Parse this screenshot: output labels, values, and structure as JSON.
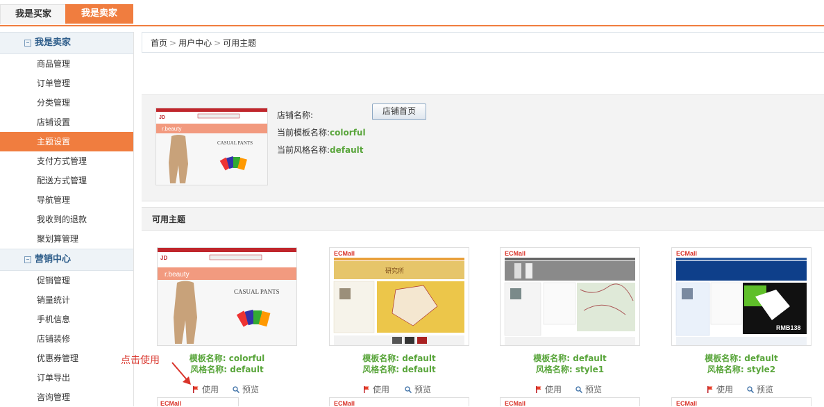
{
  "top_tabs": {
    "buyer": "我是买家",
    "seller": "我是卖家"
  },
  "sidebar": {
    "seller_section": "我是卖家",
    "seller_items": [
      "商品管理",
      "订单管理",
      "分类管理",
      "店铺设置",
      "主题设置",
      "支付方式管理",
      "配送方式管理",
      "导航管理",
      "我收到的退款",
      "聚划算管理"
    ],
    "active_index": 4,
    "marketing_section": "营销中心",
    "marketing_items": [
      "促销管理",
      "销量统计",
      "手机信息",
      "店铺装修",
      "优惠券管理",
      "订单导出",
      "咨询管理"
    ]
  },
  "breadcrumb": {
    "home": "首页",
    "sep": ">",
    "user_center": "用户中心",
    "current": "可用主题"
  },
  "store": {
    "name_label": "店铺名称:",
    "home_button": "店铺首页",
    "template_label": "当前模板名称:",
    "template_value": "colorful",
    "style_label": "当前风格名称:",
    "style_value": "default"
  },
  "available_title": "可用主题",
  "themes": [
    {
      "template": "模板名称: colorful",
      "style": "风格名称: default",
      "kind": "colorful"
    },
    {
      "template": "模板名称: default",
      "style": "风格名称: default",
      "kind": "ecmall-default"
    },
    {
      "template": "模板名称: default",
      "style": "风格名称: style1",
      "kind": "ecmall-style1"
    },
    {
      "template": "模板名称: default",
      "style": "风格名称: style2",
      "kind": "ecmall-style2"
    }
  ],
  "actions": {
    "use": "使用",
    "preview": "预览"
  },
  "annotation": "点击使用",
  "thumb_text": {
    "brand_logo": "JD",
    "beauty": "r.beauty",
    "casual_pants": "CASUAL PANTS",
    "ecmall_logo": "ECMall",
    "research": "研究所",
    "banner_code": "RMB138"
  },
  "colors": {
    "accent": "#f07d3f",
    "green": "#59a53b",
    "link_blue": "#2e5d8a",
    "hint_red": "#d9342b"
  }
}
